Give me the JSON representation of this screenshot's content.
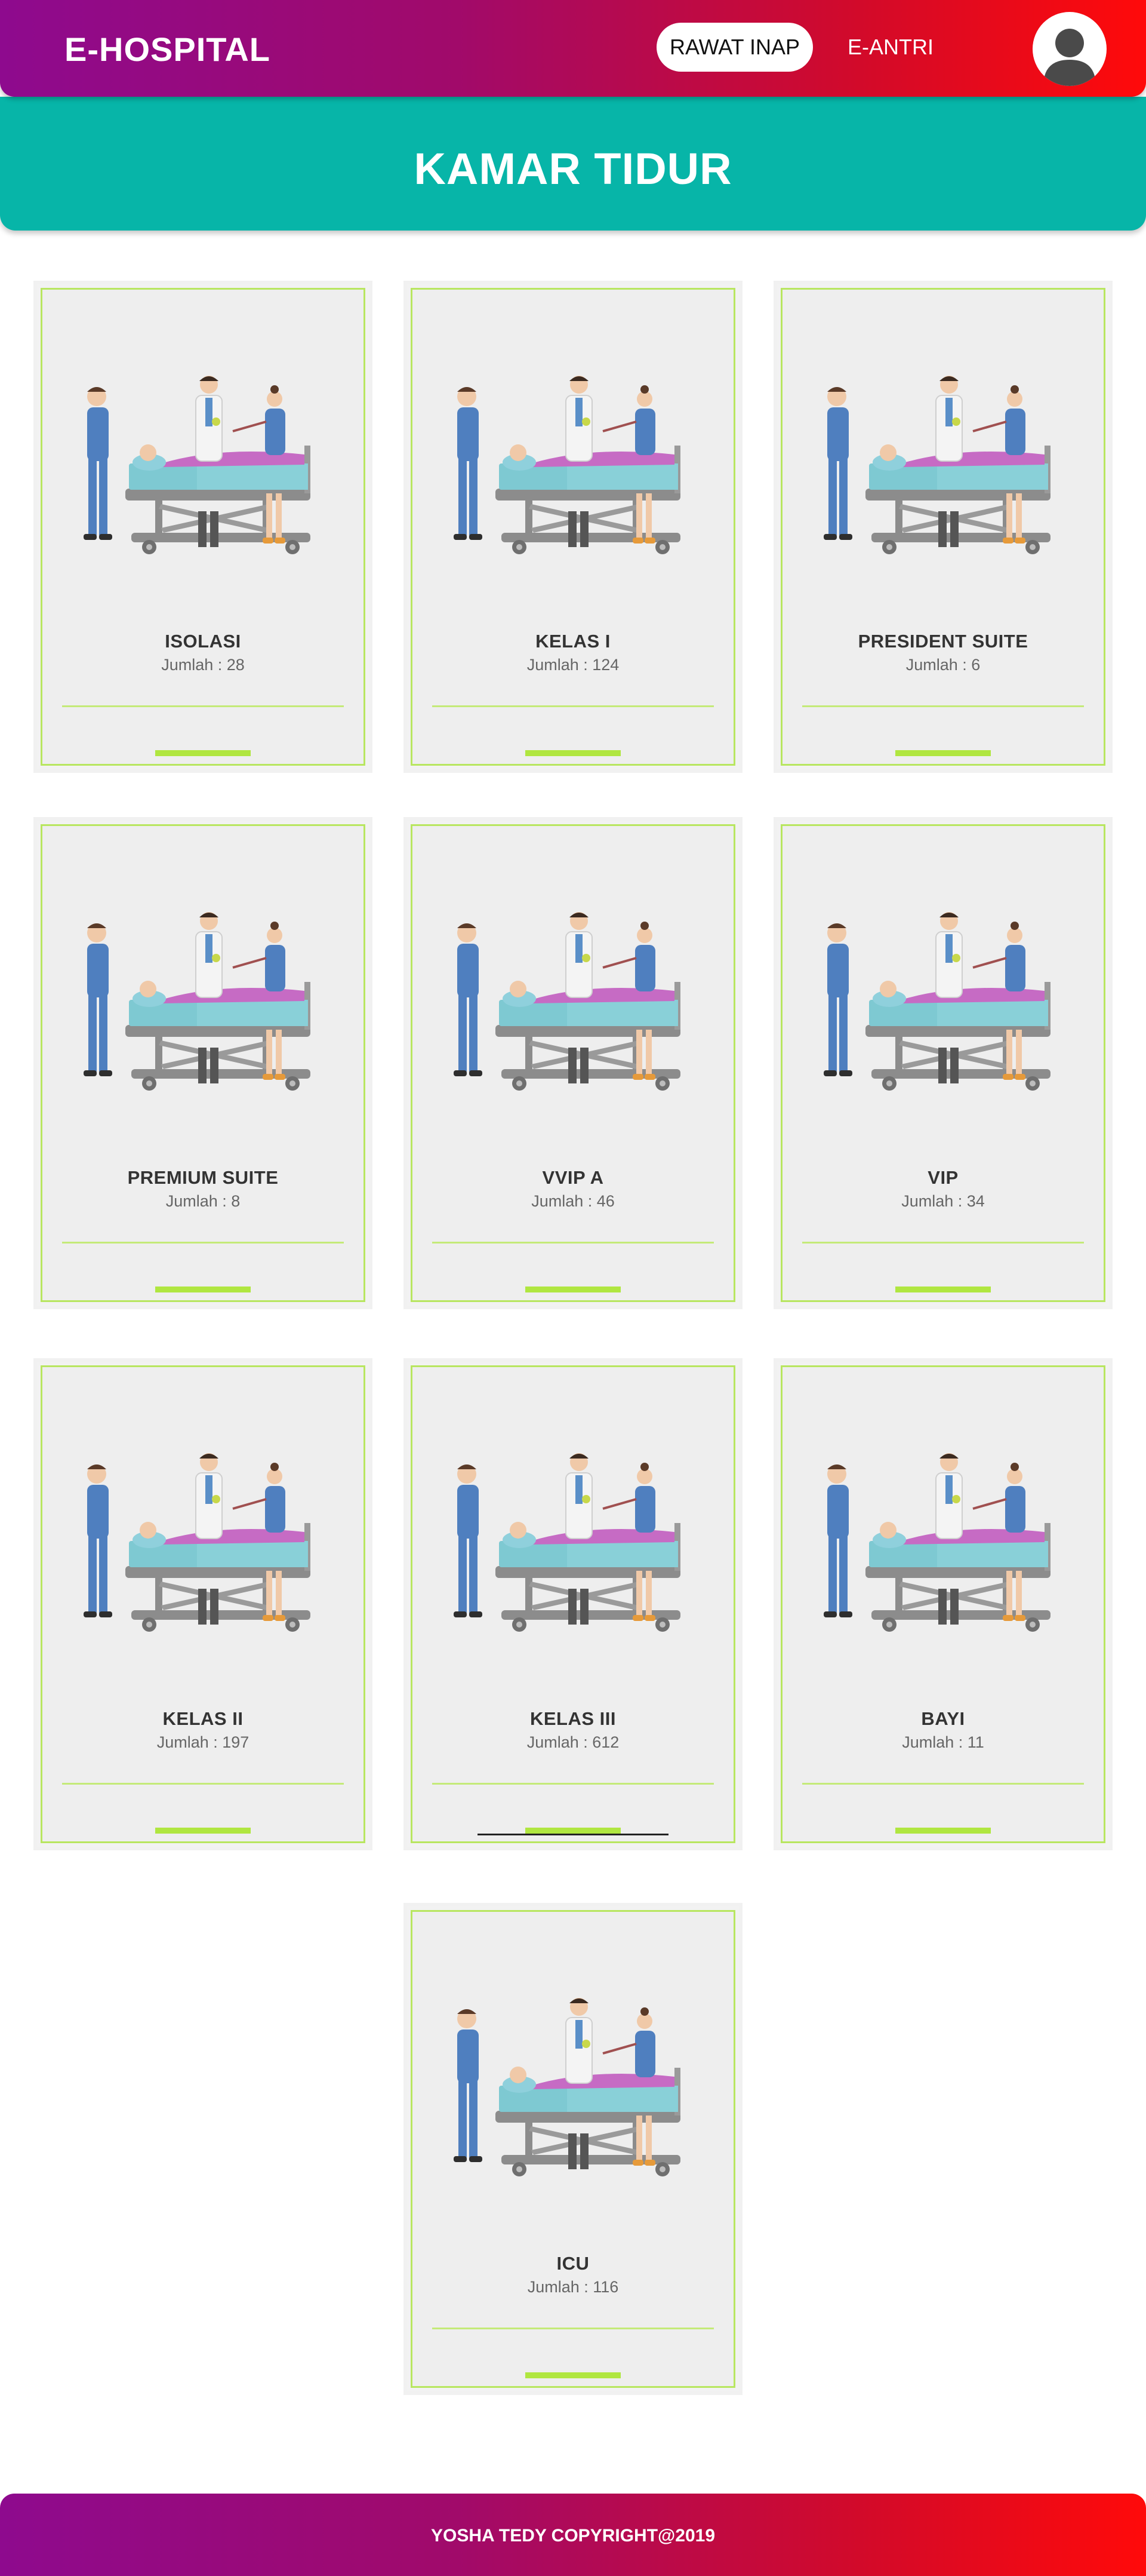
{
  "navbar": {
    "brand": "E-HOSPITAL",
    "links": [
      {
        "label": "RAWAT INAP",
        "active": true
      },
      {
        "label": "E-ANTRI",
        "active": false
      }
    ],
    "avatar_icon": "user-avatar-icon"
  },
  "banner": {
    "title": "KAMAR TIDUR",
    "color": "#07b5a8"
  },
  "rooms": [
    {
      "name": "ISOLASI",
      "count": "Jumlah : 28"
    },
    {
      "name": "KELAS I",
      "count": "Jumlah : 124"
    },
    {
      "name": "PRESIDENT SUITE",
      "count": "Jumlah : 6"
    },
    {
      "name": "PREMIUM SUITE",
      "count": "Jumlah : 8"
    },
    {
      "name": "VVIP A",
      "count": "Jumlah : 46"
    },
    {
      "name": "VIP",
      "count": "Jumlah : 34"
    },
    {
      "name": "KELAS II",
      "count": "Jumlah : 197"
    },
    {
      "name": "KELAS III",
      "count": "Jumlah : 612"
    },
    {
      "name": "BAYI",
      "count": "Jumlah : 11"
    },
    {
      "name": "ICU",
      "count": "Jumlah : 116"
    }
  ],
  "card_image_icon": "hospital-bed-patient-illustration",
  "footer": {
    "text": "YOSHA TEDY COPYRIGHT@2019"
  },
  "colors": {
    "gradient_start": "#8e0a8e",
    "gradient_end": "#ff0a0a",
    "card_border": "#b8e660",
    "card_background": "#eeeeee"
  }
}
